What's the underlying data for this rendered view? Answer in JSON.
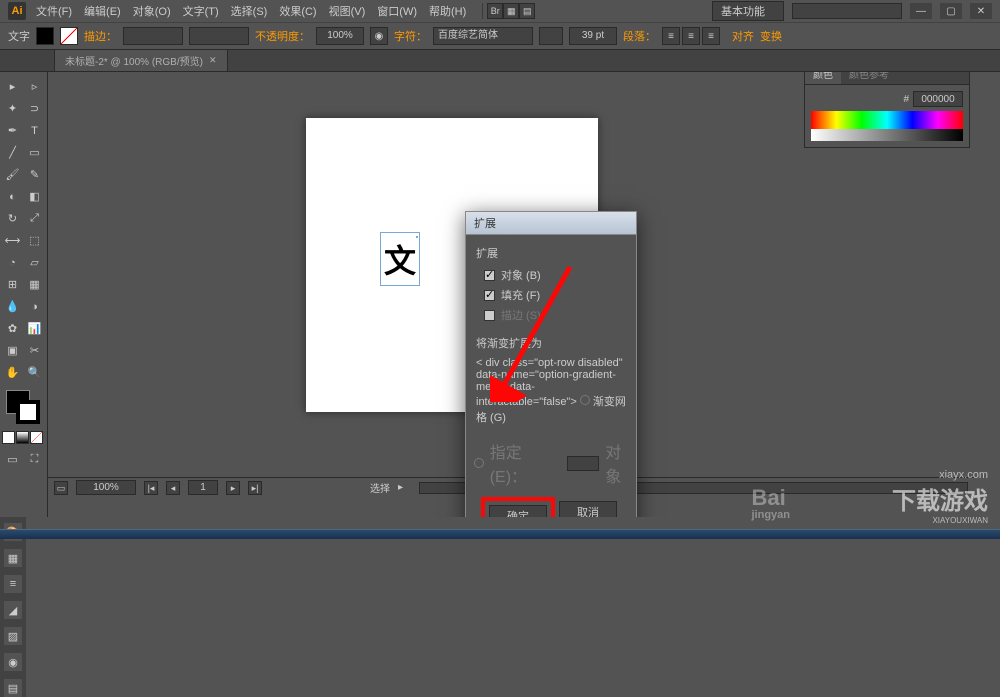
{
  "menubar": {
    "items": [
      "文件(F)",
      "编辑(E)",
      "对象(O)",
      "文字(T)",
      "选择(S)",
      "效果(C)",
      "视图(V)",
      "窗口(W)",
      "帮助(H)"
    ],
    "workspace_label": "基本功能",
    "search_placeholder": ""
  },
  "controlbar": {
    "tool_label": "文字",
    "stroke_label": "描边：",
    "opacity_label": "不透明度：",
    "opacity_value": "100%",
    "char_label": "字符：",
    "font_name": "百度综艺简体",
    "font_size": "39 pt",
    "paragraph_label": "段落：",
    "align_label": "对齐",
    "transform_label": "变换"
  },
  "tab": {
    "title": "未标题-2* @ 100% (RGB/预览)"
  },
  "artboard": {
    "text_content": "文"
  },
  "dialog": {
    "title": "扩展",
    "section1": "扩展",
    "opt_object": "对象 (B)",
    "opt_fill": "填充 (F)",
    "opt_stroke": "描边 (S)",
    "section2": "将渐变扩展为",
    "opt_gradient_mesh": "渐变网格 (G)",
    "opt_specify": "指定 (E)：",
    "specify_unit": "对象",
    "btn_ok": "确定",
    "btn_cancel": "取消"
  },
  "color_panel": {
    "tab1": "颜色",
    "tab2": "颜色参考",
    "hex": "000000"
  },
  "statusbar": {
    "zoom": "100%",
    "page": "1",
    "tool_hint": "选择"
  },
  "watermark": {
    "baidu": "Bai",
    "jingyan": "jingyan",
    "xiayx_url": "xiayx.com",
    "xiayx_main": "下载游戏",
    "xiayx_py": "XIAYOUXIWAN"
  },
  "icons": {
    "ai": "Ai"
  }
}
